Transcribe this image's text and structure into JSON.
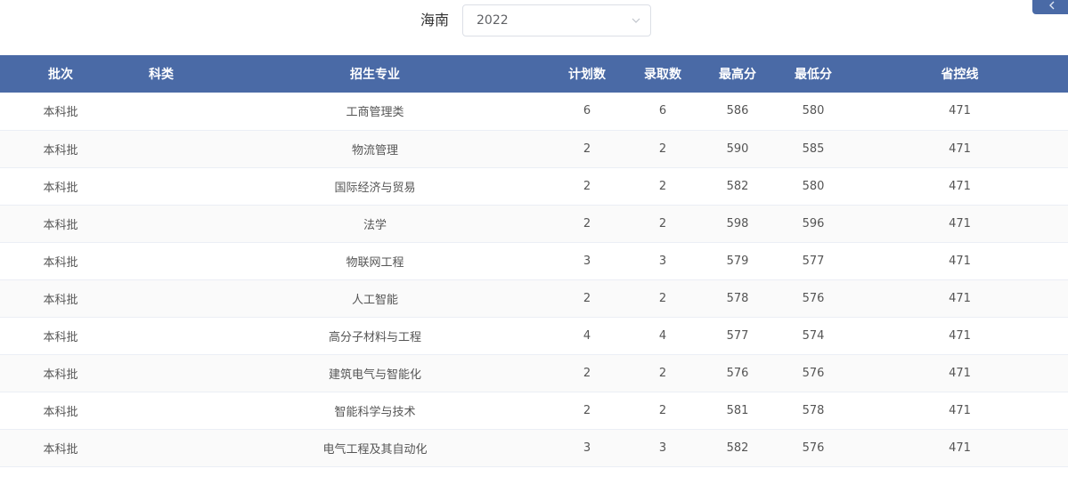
{
  "filter": {
    "province": "海南",
    "year": "2022"
  },
  "icons": {
    "select_chevron": "chevron-down-icon",
    "corner": "chevron-left-icon"
  },
  "colors": {
    "header_bg": "#4a6aa6",
    "header_text": "#ffffff",
    "stripe": "#fafafa"
  },
  "table": {
    "columns": [
      "批次",
      "科类",
      "招生专业",
      "计划数",
      "录取数",
      "最高分",
      "最低分",
      "省控线"
    ],
    "rows": [
      {
        "batch": "本科批",
        "category": "",
        "major": "工商管理类",
        "plan": "6",
        "admitted": "6",
        "max": "586",
        "min": "580",
        "control": "471"
      },
      {
        "batch": "本科批",
        "category": "",
        "major": "物流管理",
        "plan": "2",
        "admitted": "2",
        "max": "590",
        "min": "585",
        "control": "471"
      },
      {
        "batch": "本科批",
        "category": "",
        "major": "国际经济与贸易",
        "plan": "2",
        "admitted": "2",
        "max": "582",
        "min": "580",
        "control": "471"
      },
      {
        "batch": "本科批",
        "category": "",
        "major": "法学",
        "plan": "2",
        "admitted": "2",
        "max": "598",
        "min": "596",
        "control": "471"
      },
      {
        "batch": "本科批",
        "category": "",
        "major": "物联网工程",
        "plan": "3",
        "admitted": "3",
        "max": "579",
        "min": "577",
        "control": "471"
      },
      {
        "batch": "本科批",
        "category": "",
        "major": "人工智能",
        "plan": "2",
        "admitted": "2",
        "max": "578",
        "min": "576",
        "control": "471"
      },
      {
        "batch": "本科批",
        "category": "",
        "major": "高分子材料与工程",
        "plan": "4",
        "admitted": "4",
        "max": "577",
        "min": "574",
        "control": "471"
      },
      {
        "batch": "本科批",
        "category": "",
        "major": "建筑电气与智能化",
        "plan": "2",
        "admitted": "2",
        "max": "576",
        "min": "576",
        "control": "471"
      },
      {
        "batch": "本科批",
        "category": "",
        "major": "智能科学与技术",
        "plan": "2",
        "admitted": "2",
        "max": "581",
        "min": "578",
        "control": "471"
      },
      {
        "batch": "本科批",
        "category": "",
        "major": "电气工程及其自动化",
        "plan": "3",
        "admitted": "3",
        "max": "582",
        "min": "576",
        "control": "471"
      }
    ]
  }
}
